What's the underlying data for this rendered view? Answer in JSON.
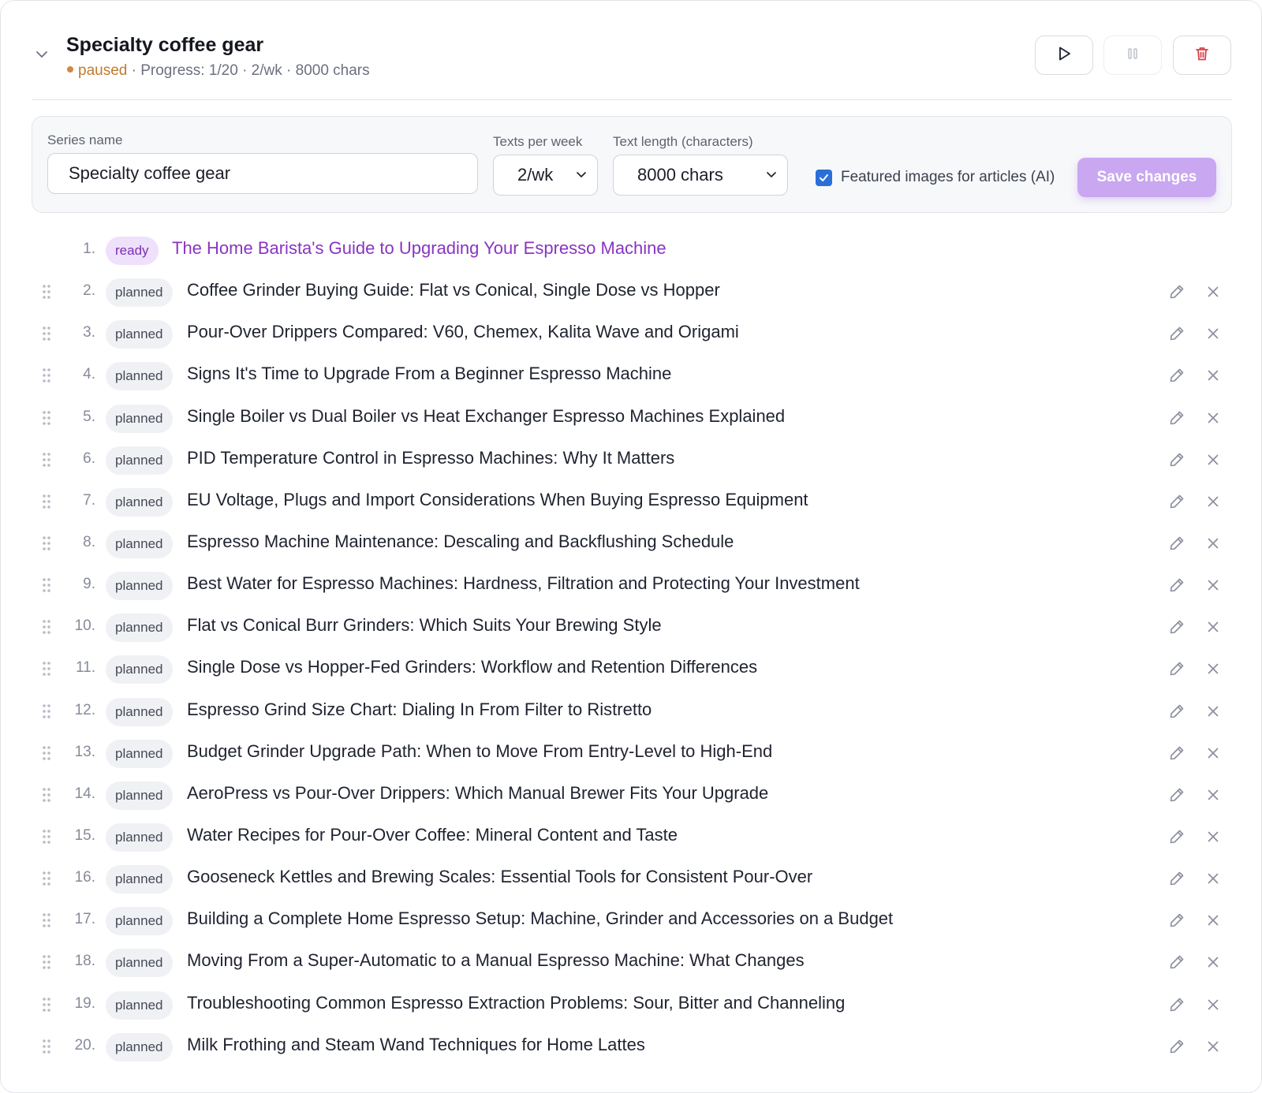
{
  "header": {
    "title": "Specialty coffee gear",
    "status": "paused",
    "meta": " · Progress: 1/20 · 2/wk · 8000 chars",
    "collapse_icon": "chevron-down-icon",
    "buttons": [
      "play-icon",
      "pause-icon",
      "trash-icon"
    ]
  },
  "settings": {
    "series_name_label": "Series name",
    "series_name_value": "Specialty coffee gear",
    "texts_per_week_label": "Texts per week",
    "texts_per_week_value": "2/wk",
    "text_length_label": "Text length (characters)",
    "text_length_value": "8000 chars",
    "featured_images_label": "Featured images for articles (AI)",
    "featured_images_checked": true,
    "save_label": "Save changes"
  },
  "colors": {
    "accent_purple": "#8a34c2",
    "save_button": "#c9a7f1",
    "paused_status": "#c27a2e",
    "checkbox": "#2a6fd8"
  },
  "items": [
    {
      "num": "1.",
      "status": "ready",
      "title": "The Home Barista's Guide to Upgrading Your Espresso Machine"
    },
    {
      "num": "2.",
      "status": "planned",
      "title": "Coffee Grinder Buying Guide: Flat vs Conical, Single Dose vs Hopper"
    },
    {
      "num": "3.",
      "status": "planned",
      "title": "Pour-Over Drippers Compared: V60, Chemex, Kalita Wave and Origami"
    },
    {
      "num": "4.",
      "status": "planned",
      "title": "Signs It's Time to Upgrade From a Beginner Espresso Machine"
    },
    {
      "num": "5.",
      "status": "planned",
      "title": "Single Boiler vs Dual Boiler vs Heat Exchanger Espresso Machines Explained"
    },
    {
      "num": "6.",
      "status": "planned",
      "title": "PID Temperature Control in Espresso Machines: Why It Matters"
    },
    {
      "num": "7.",
      "status": "planned",
      "title": "EU Voltage, Plugs and Import Considerations When Buying Espresso Equipment"
    },
    {
      "num": "8.",
      "status": "planned",
      "title": "Espresso Machine Maintenance: Descaling and Backflushing Schedule"
    },
    {
      "num": "9.",
      "status": "planned",
      "title": "Best Water for Espresso Machines: Hardness, Filtration and Protecting Your Investment"
    },
    {
      "num": "10.",
      "status": "planned",
      "title": "Flat vs Conical Burr Grinders: Which Suits Your Brewing Style"
    },
    {
      "num": "11.",
      "status": "planned",
      "title": "Single Dose vs Hopper-Fed Grinders: Workflow and Retention Differences"
    },
    {
      "num": "12.",
      "status": "planned",
      "title": "Espresso Grind Size Chart: Dialing In From Filter to Ristretto"
    },
    {
      "num": "13.",
      "status": "planned",
      "title": "Budget Grinder Upgrade Path: When to Move From Entry-Level to High-End"
    },
    {
      "num": "14.",
      "status": "planned",
      "title": "AeroPress vs Pour-Over Drippers: Which Manual Brewer Fits Your Upgrade"
    },
    {
      "num": "15.",
      "status": "planned",
      "title": "Water Recipes for Pour-Over Coffee: Mineral Content and Taste"
    },
    {
      "num": "16.",
      "status": "planned",
      "title": "Gooseneck Kettles and Brewing Scales: Essential Tools for Consistent Pour-Over"
    },
    {
      "num": "17.",
      "status": "planned",
      "title": "Building a Complete Home Espresso Setup: Machine, Grinder and Accessories on a Budget"
    },
    {
      "num": "18.",
      "status": "planned",
      "title": "Moving From a Super-Automatic to a Manual Espresso Machine: What Changes"
    },
    {
      "num": "19.",
      "status": "planned",
      "title": "Troubleshooting Common Espresso Extraction Problems: Sour, Bitter and Channeling"
    },
    {
      "num": "20.",
      "status": "planned",
      "title": "Milk Frothing and Steam Wand Techniques for Home Lattes"
    }
  ]
}
